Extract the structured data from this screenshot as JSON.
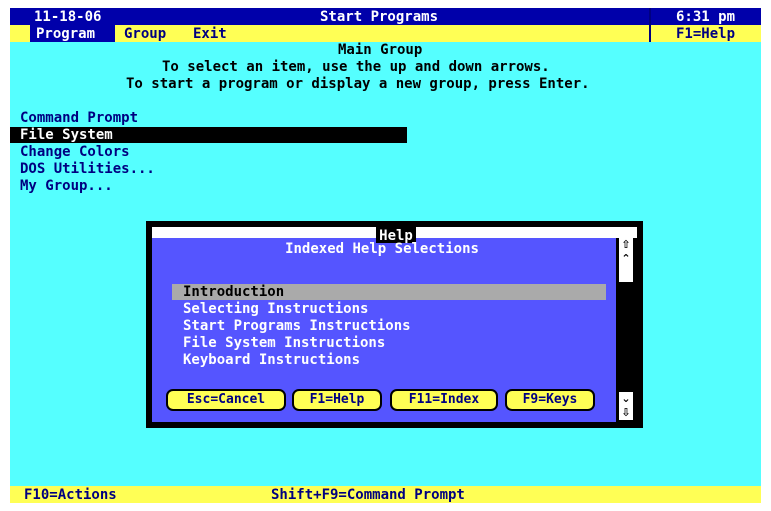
{
  "title_bar": {
    "date": "11-18-06",
    "title": "Start Programs",
    "time": "6:31 pm"
  },
  "menu_bar": {
    "items": [
      "Program",
      "Group",
      "Exit"
    ],
    "help_hint": "F1=Help"
  },
  "header": {
    "group_name": "Main Group",
    "instruction_1": "To select an item, use the up and down arrows.",
    "instruction_2": "To start a program or display a new group, press Enter."
  },
  "programs": [
    "Command Prompt",
    "File System",
    "Change Colors",
    "DOS Utilities...",
    "My Group..."
  ],
  "selected_program": "File System",
  "help_dialog": {
    "title": "Help",
    "subtitle": "Indexed Help Selections",
    "items": [
      "Introduction",
      "Selecting Instructions",
      "Start Programs Instructions",
      "File System Instructions",
      "Keyboard Instructions"
    ],
    "selected_item": "Introduction",
    "buttons": [
      "Esc=Cancel",
      "F1=Help",
      "F11=Index",
      "F9=Keys"
    ]
  },
  "status_bar": {
    "left": "F10=Actions",
    "center": "Shift+F9=Command Prompt"
  },
  "colors": {
    "background": "#55FFFF",
    "bars": "#FFFF55",
    "title": "#0000AA",
    "dialog": "#5555FF"
  }
}
